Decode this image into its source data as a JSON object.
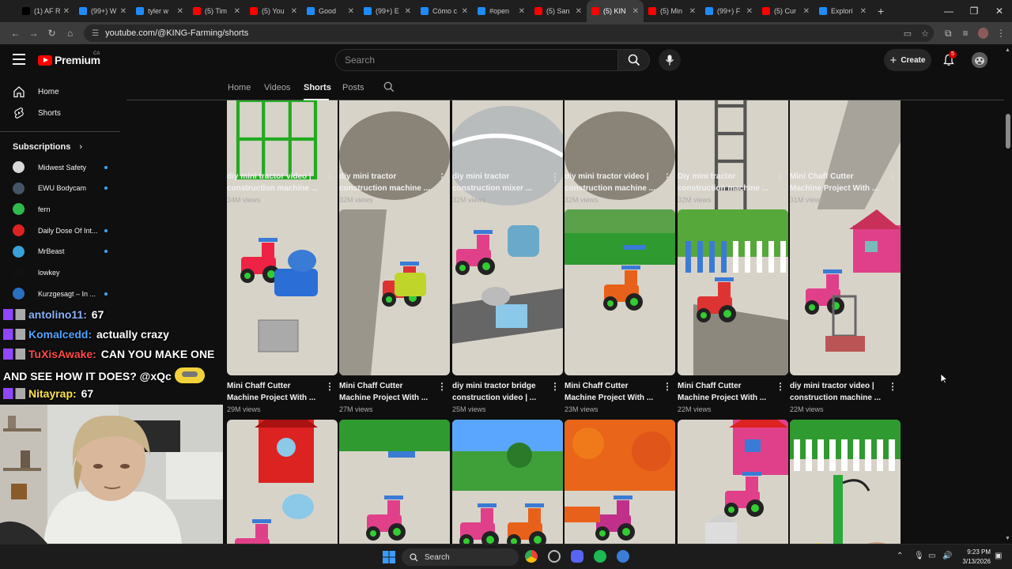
{
  "browser": {
    "tabs": [
      {
        "label": "(1) AF R",
        "color": "#000000",
        "icon": "x-logo-icon"
      },
      {
        "label": "(99+) W",
        "color": "#1f8bff",
        "icon": "tiktok-icon"
      },
      {
        "label": "tyler w",
        "color": "#1f8bff",
        "icon": "tiktok-icon"
      },
      {
        "label": "(5) Tim",
        "color": "#ff0000",
        "icon": "youtube-icon"
      },
      {
        "label": "(5) You",
        "color": "#ff0000",
        "icon": "youtube-icon"
      },
      {
        "label": "Good",
        "color": "#1f8bff",
        "icon": "tiktok-icon"
      },
      {
        "label": "(99+) E",
        "color": "#1f8bff",
        "icon": "tiktok-icon"
      },
      {
        "label": "Cómo c",
        "color": "#1f8bff",
        "icon": "tiktok-icon"
      },
      {
        "label": "#open",
        "color": "#1f8bff",
        "icon": "tiktok-icon"
      },
      {
        "label": "(5) San",
        "color": "#ff0000",
        "icon": "youtube-icon"
      },
      {
        "label": "(5) KIN",
        "color": "#ff0000",
        "icon": "youtube-icon",
        "active": true
      },
      {
        "label": "(5) Min",
        "color": "#ff0000",
        "icon": "youtube-icon"
      },
      {
        "label": "(99+) F",
        "color": "#1f8bff",
        "icon": "tiktok-icon"
      },
      {
        "label": "(5) Cur",
        "color": "#ff0000",
        "icon": "youtube-icon"
      },
      {
        "label": "Explori",
        "color": "#1f8bff",
        "icon": "tiktok-icon"
      }
    ],
    "url": "youtube.com/@KING-Farming/shorts"
  },
  "masthead": {
    "logo_text": "Premium",
    "country": "CA",
    "search_placeholder": "Search",
    "create_label": "Create",
    "notification_count": "5"
  },
  "guide": {
    "home": "Home",
    "shorts": "Shorts",
    "subscriptions_label": "Subscriptions",
    "subscriptions": [
      {
        "name": "Midwest Safety",
        "color": "#d8d8d8",
        "live": true
      },
      {
        "name": "EWU Bodycam",
        "color": "#445566",
        "live": true
      },
      {
        "name": "fern",
        "color": "#2dbb4e",
        "live": false
      },
      {
        "name": "Daily Dose Of Int...",
        "color": "#dd2222",
        "live": true
      },
      {
        "name": "MrBeast",
        "color": "#3aa0d8",
        "live": true
      },
      {
        "name": "lowkey",
        "color": "#111111",
        "live": false
      },
      {
        "name": "Kurzgesagt – In ...",
        "color": "#2b6fbf",
        "live": true
      }
    ]
  },
  "channel_tabs": [
    "Home",
    "Videos",
    "Shorts",
    "Posts"
  ],
  "shorts": [
    {
      "title": "diy mini tractor video |\nconstruction machine ...",
      "views": "34M views",
      "theme": "green-grid"
    },
    {
      "title": "diy mini tractor\nconstruction machine ...",
      "views": "32M views",
      "theme": "mud"
    },
    {
      "title": "diy mini tractor\nconstruction mixer ...",
      "views": "32M views",
      "theme": "water"
    },
    {
      "title": "diy mini tractor video |\nconstruction machine ...",
      "views": "32M views",
      "theme": "mud"
    },
    {
      "title": "Diy mini tractor\nconstruction machine ...",
      "views": "32M views",
      "theme": "ladder"
    },
    {
      "title": "Mini Chaff Cutter\nMachine Project With ...",
      "views": "31M views",
      "theme": "channel"
    },
    {
      "title": "Mini Chaff Cutter\nMachine Project With ...",
      "views": "29M views",
      "theme": "blue-tractor"
    },
    {
      "title": "Mini Chaff Cutter\nMachine Project With ...",
      "views": "27M views",
      "theme": "green-tractor"
    },
    {
      "title": "diy mini tractor bridge\nconstruction video | ...",
      "views": "25M views",
      "theme": "pink-mixer"
    },
    {
      "title": "Mini Chaff Cutter\nMachine Project With ...",
      "views": "23M views",
      "theme": "orange-tractor"
    },
    {
      "title": "Mini Chaff Cutter\nMachine Project With ...",
      "views": "22M views",
      "theme": "fence"
    },
    {
      "title": "diy mini tractor video |\nconstruction machine ...",
      "views": "22M views",
      "theme": "house-mixer"
    },
    {
      "title": "",
      "views": "",
      "theme": "house-pour"
    },
    {
      "title": "",
      "views": "",
      "theme": "pink-tractor"
    },
    {
      "title": "",
      "views": "",
      "theme": "tree-tractor"
    },
    {
      "title": "",
      "views": "",
      "theme": "flowers-trailer"
    },
    {
      "title": "",
      "views": "",
      "theme": "house-cup"
    },
    {
      "title": "",
      "views": "",
      "theme": "pump"
    }
  ],
  "chat": [
    {
      "user": "antolino11:",
      "msg": " 67",
      "color": "#8ab4f8"
    },
    {
      "user": "Komalcedd:",
      "msg": " actually crazy",
      "color": "#4fa3ff"
    },
    {
      "user": "TuXisAwake:",
      "msg": " CAN YOU MAKE ONE",
      "color": "#ff4a4a"
    },
    {
      "user": "",
      "msg": "AND SEE HOW IT DOES? @xQc",
      "color": "#ffffff"
    },
    {
      "user": "Nitayrap:",
      "msg": " 67",
      "color": "#ffe14a"
    }
  ],
  "taskbar": {
    "search_label": "Search",
    "time": "9:23 PM",
    "date": "3/13/2026"
  }
}
